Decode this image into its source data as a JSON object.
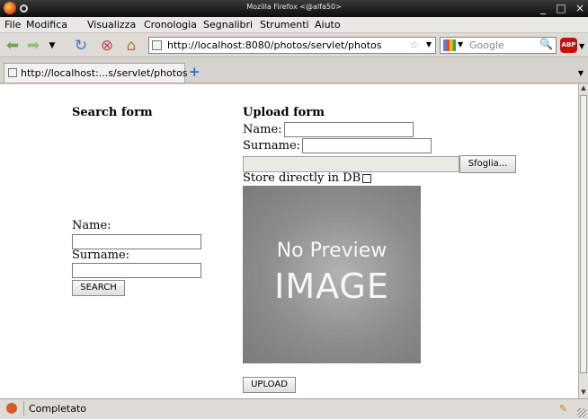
{
  "window": {
    "title": "Mozilla Firefox <@alfa50>",
    "controls": {
      "minimize": "_",
      "maximize": "□",
      "close": "×"
    }
  },
  "menu": [
    "File",
    "Modifica",
    "Visualizza",
    "Cronologia",
    "Segnalibri",
    "Strumenti",
    "Aiuto"
  ],
  "toolbar": {
    "url": "http://localhost:8080/photos/servlet/photos",
    "search_placeholder": "Google",
    "icons": [
      "back-icon",
      "forward-icon",
      "history-dropdown-icon",
      "reload-icon",
      "stop-icon",
      "home-icon",
      "adblock-icon"
    ],
    "adblock_label": "ABP"
  },
  "tabs": [
    {
      "label": "http://localhost:...s/servlet/photos"
    }
  ],
  "page": {
    "search_form": {
      "title": "Search form",
      "name_label": "Name:",
      "surname_label": "Surname:",
      "name_value": "",
      "surname_value": "",
      "button": "SEARCH"
    },
    "upload_form": {
      "title": "Upload form",
      "name_label": "Name:",
      "surname_label": "Surname:",
      "name_value": "",
      "surname_value": "",
      "file_value": "",
      "browse_button": "Sfoglia...",
      "store_label": "Store directly in DB",
      "store_checked": false,
      "preview_line1": "No Preview",
      "preview_line2": "IMAGE",
      "button": "UPLOAD"
    }
  },
  "status": {
    "text": "Completato"
  }
}
